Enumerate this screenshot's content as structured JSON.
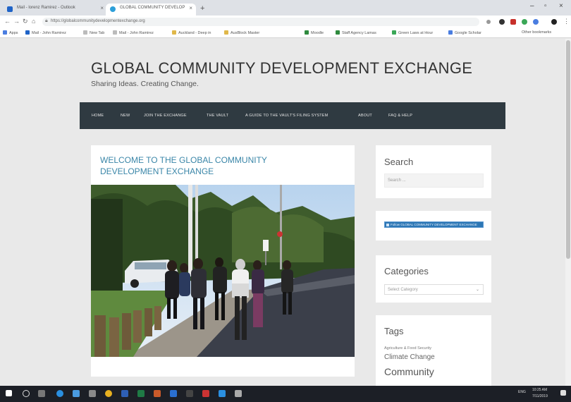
{
  "browser": {
    "tabs": [
      {
        "label": "Mail - lorenz Ramirez - Outlook"
      },
      {
        "label": "GLOBAL COMMUNITY DEVELOP"
      }
    ],
    "url": "https://globalcommunitydevelopmentexchange.org",
    "bookmarks": [
      "Apps",
      "Mail - John Ramirez",
      "New Tab",
      "Mail - John Ramirez",
      "Auckland - Deep in",
      "AusBlock Master",
      "Moodle",
      "Staff Agency Lamas",
      "Green Laws at Hour",
      "Google Scholar",
      "Other bookmarks"
    ]
  },
  "site": {
    "title": "GLOBAL COMMUNITY DEVELOPMENT EXCHANGE",
    "tagline": "Sharing Ideas. Creating Change."
  },
  "nav": [
    "HOME",
    "NEW",
    "JOIN THE EXCHANGE",
    "THE VAULT",
    "A GUIDE TO THE VAULT'S FILING SYSTEM",
    "ABOUT",
    "FAQ & HELP"
  ],
  "post": {
    "title": "WELCOME TO THE GLOBAL COMMUNITY DEVELOPMENT EXCHANGE"
  },
  "sidebar": {
    "search_title": "Search",
    "search_placeholder": "Search ...",
    "facebook_label": "Follow GLOBAL COMMUNITY DEVELOPMENT EXCHANGE",
    "categories_title": "Categories",
    "categories_select": "Select Category",
    "tags_title": "Tags",
    "tags": [
      "Agriculture & Food Security",
      "Climate Change",
      "Community"
    ]
  },
  "taskbar": {
    "time": "10:25 AM",
    "date": "7/11/2019",
    "lang": "ENG"
  },
  "colors": {
    "nav_bg": "#2f3a41",
    "post_title": "#3a86a8",
    "page_bg": "#e9e9e9"
  }
}
